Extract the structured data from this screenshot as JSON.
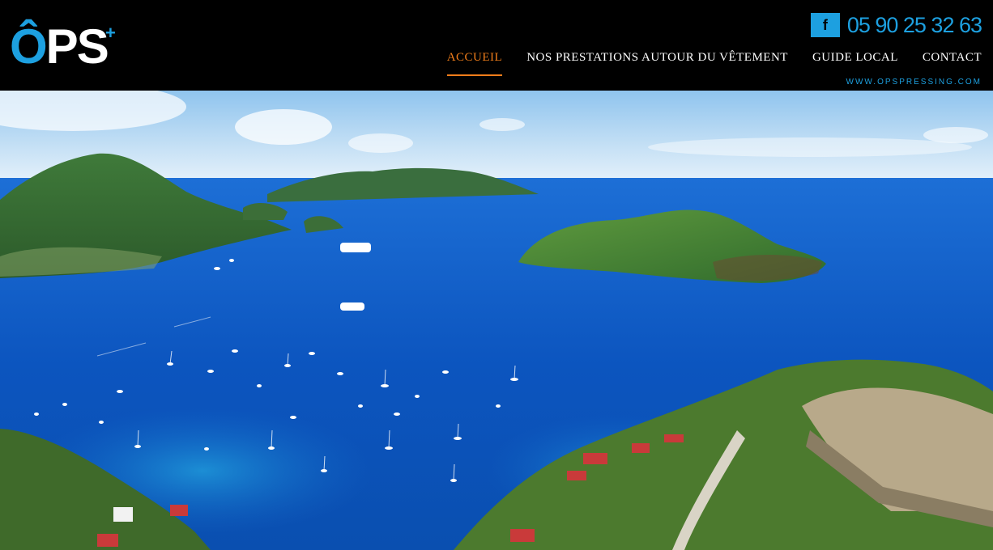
{
  "brand": {
    "logo_text": "ÔPS",
    "logo_plus": "+"
  },
  "contact": {
    "facebook_label": "f",
    "phone": "05 90 25 32 63"
  },
  "nav": {
    "items": [
      {
        "label": "ACCUEIL",
        "active": true
      },
      {
        "label": "NOS PRESTATIONS AUTOUR DU VÊTEMENT",
        "active": false
      },
      {
        "label": "GUIDE LOCAL",
        "active": false
      },
      {
        "label": "CONTACT",
        "active": false
      }
    ]
  },
  "site_url": "WWW.OPSPRESSING.COM",
  "colors": {
    "accent_blue": "#1da0e0",
    "active_orange": "#f07d1a",
    "header_bg": "#000000"
  },
  "hero": {
    "icon": "panoramic-bay-photo"
  }
}
